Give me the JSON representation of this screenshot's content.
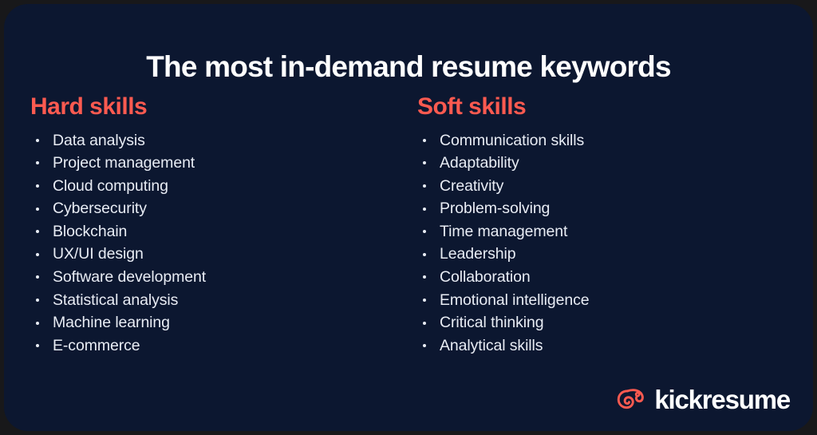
{
  "card": {
    "title": "The most in-demand resume keywords",
    "background_color": "#0c1730",
    "accent_color": "#fc5a50",
    "text_color": "#e8ecf4"
  },
  "columns": [
    {
      "heading": "Hard skills",
      "items": [
        "Data analysis",
        "Project management",
        "Cloud computing",
        "Cybersecurity",
        "Blockchain",
        "UX/UI design",
        "Software development",
        "Statistical analysis",
        "Machine learning",
        "E-commerce"
      ]
    },
    {
      "heading": "Soft skills",
      "items": [
        "Communication skills",
        "Adaptability",
        "Creativity",
        "Problem-solving",
        "Time management",
        "Leadership",
        "Collaboration",
        "Emotional intelligence",
        "Critical thinking",
        "Analytical skills"
      ]
    }
  ],
  "brand": {
    "name": "kickresume",
    "logo_icon": "chameleon-icon",
    "logo_color": "#fc5a50",
    "name_color": "#ffffff"
  }
}
